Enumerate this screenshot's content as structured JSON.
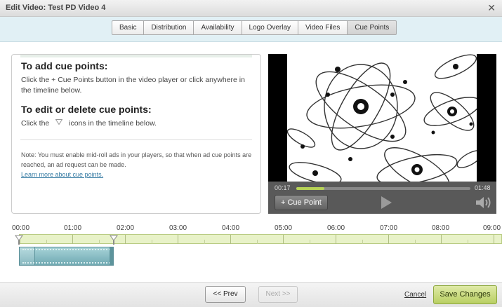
{
  "window": {
    "title": "Edit Video: Test PD Video 4",
    "close_glyph": "✕"
  },
  "tabs": [
    {
      "label": "Basic"
    },
    {
      "label": "Distribution"
    },
    {
      "label": "Availability"
    },
    {
      "label": "Logo Overlay"
    },
    {
      "label": "Video Files"
    },
    {
      "label": "Cue Points",
      "active": true
    }
  ],
  "info": {
    "add_heading": "To add cue points:",
    "add_text": "Click the + Cue Points button in the video player or click anywhere in the timeline below.",
    "edit_heading": "To edit or delete cue points:",
    "edit_prefix": "Click the",
    "edit_suffix": "icons in the timeline below.",
    "note": "Note: You must enable mid-roll ads in your players, so that when ad cue points are reached, an ad request can be made.",
    "learn_more": "Learn more about cue points."
  },
  "player": {
    "current_time": "00:17",
    "duration": "01:48",
    "progress_fraction": 0.16,
    "add_cue_label": "+ Cue Point",
    "play_icon": "play-icon",
    "volume_icon": "volume-icon"
  },
  "timeline": {
    "labels": [
      "00:00",
      "01:00",
      "02:00",
      "03:00",
      "04:00",
      "05:00",
      "06:00",
      "07:00",
      "08:00",
      "09:00"
    ]
  },
  "footer": {
    "prev_label": "<< Prev",
    "next_label": "Next >>",
    "cancel_label": "Cancel",
    "save_label": "Save Changes"
  },
  "colors": {
    "accent_green": "#b9cf63",
    "tab_strip": "#e1f0f5",
    "clip_teal": "#6fa9b2",
    "link": "#3a7ea5"
  }
}
